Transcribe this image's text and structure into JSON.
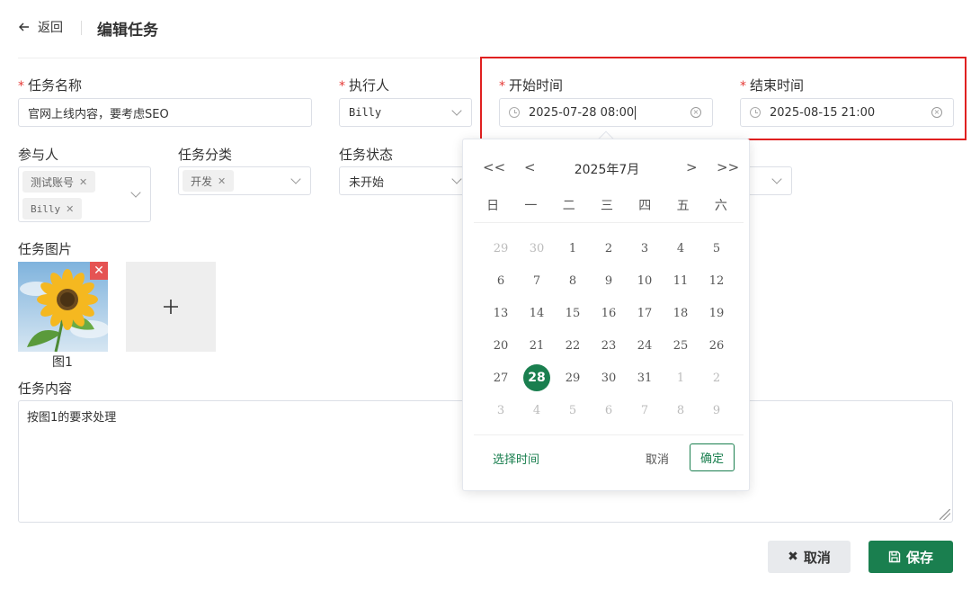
{
  "header": {
    "back_label": "返回",
    "title": "编辑任务"
  },
  "form": {
    "task_name": {
      "label": "任务名称",
      "value": "官网上线内容，要考虑SEO"
    },
    "assignee": {
      "label": "执行人",
      "value": "Billy"
    },
    "start_time": {
      "label": "开始时间",
      "value": "2025-07-28 08:00"
    },
    "end_time": {
      "label": "结束时间",
      "value": "2025-08-15 21:00"
    },
    "participants": {
      "label": "参与人",
      "tags": [
        "测试账号",
        "Billy"
      ]
    },
    "category": {
      "label": "任务分类",
      "tags": [
        "开发"
      ]
    },
    "status": {
      "label": "任务状态",
      "value": "未开始"
    },
    "images": {
      "label": "任务图片",
      "items": [
        {
          "caption": "图1"
        }
      ]
    },
    "content": {
      "label": "任务内容",
      "value": "按图1的要求处理"
    }
  },
  "buttons": {
    "cancel": "取消",
    "save": "保存"
  },
  "calendar": {
    "title": "2025年7月",
    "nav": {
      "prev_year": "<<",
      "prev_month": "<",
      "next_month": ">",
      "next_year": ">>"
    },
    "weekdays": [
      "日",
      "一",
      "二",
      "三",
      "四",
      "五",
      "六"
    ],
    "weeks": [
      [
        "29",
        "30",
        "1",
        "2",
        "3",
        "4",
        "5"
      ],
      [
        "6",
        "7",
        "8",
        "9",
        "10",
        "11",
        "12"
      ],
      [
        "13",
        "14",
        "15",
        "16",
        "17",
        "18",
        "19"
      ],
      [
        "20",
        "21",
        "22",
        "23",
        "24",
        "25",
        "26"
      ],
      [
        "27",
        "28",
        "29",
        "30",
        "31",
        "1",
        "2"
      ],
      [
        "3",
        "4",
        "5",
        "6",
        "7",
        "8",
        "9"
      ]
    ],
    "selected": "28",
    "select_time": "选择时间",
    "cancel": "取消",
    "confirm": "确定"
  },
  "colors": {
    "primary": "#1a7f4f",
    "required": "#e53935",
    "highlight": "#e02020"
  }
}
